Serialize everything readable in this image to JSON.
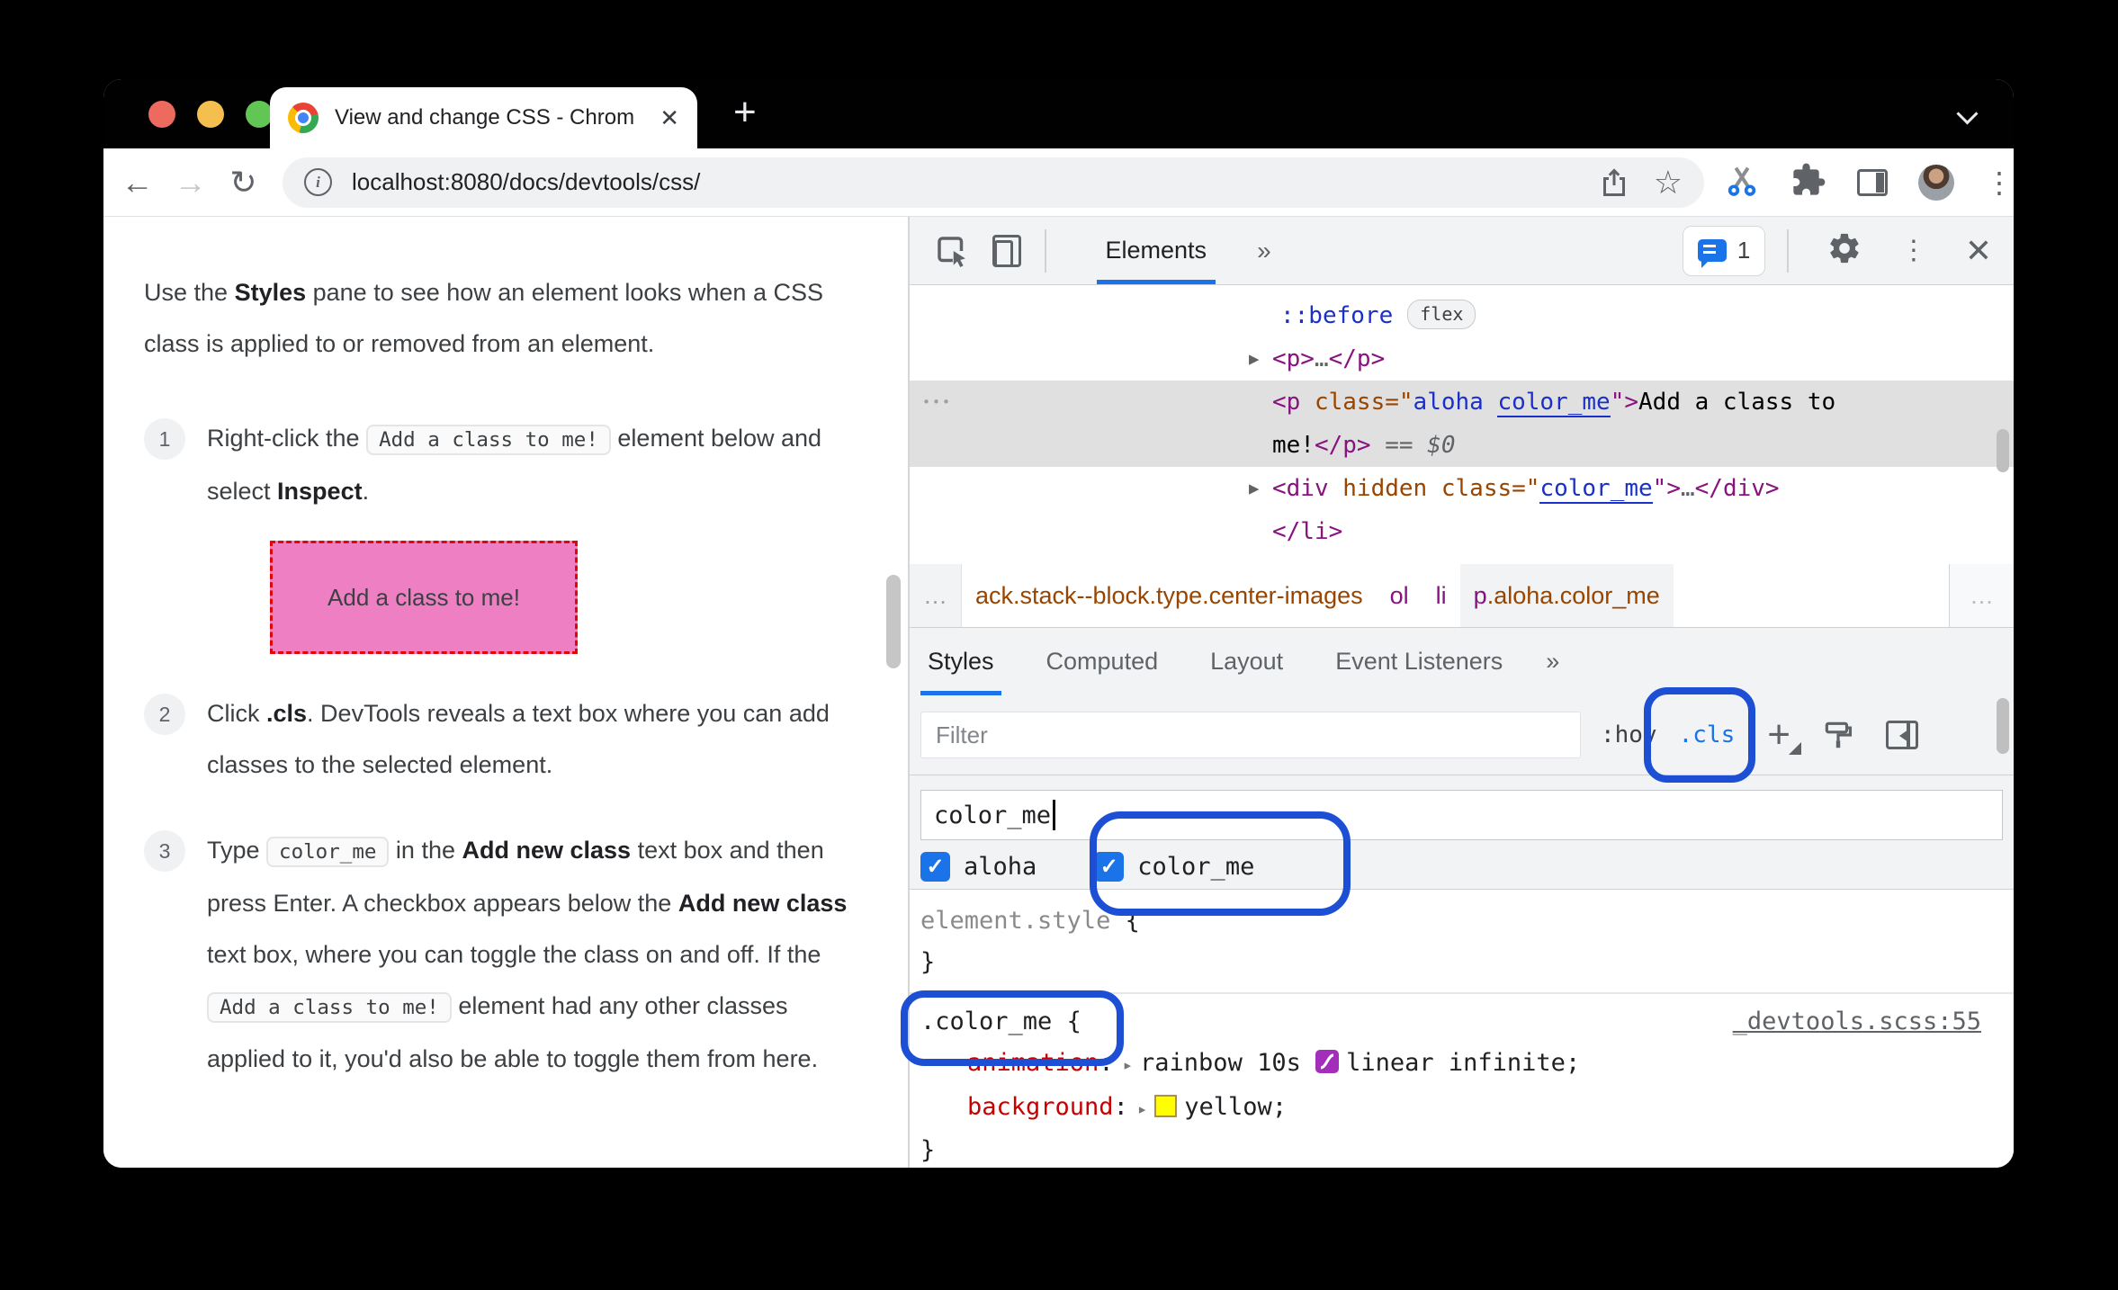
{
  "colors": {
    "accent_blue": "#1a73e8",
    "annotation_blue": "#1c4fd3",
    "tag_purple": "#881280",
    "attr_orange": "#994500",
    "value_blue": "#1a30c8",
    "property_red": "#c80000",
    "dom_selection_gray": "#e0e0e0",
    "demo_box_pink": "#ee7fc3",
    "demo_box_border_red": "#df0707",
    "swatch_yellow": "#ffff00",
    "swatch_bezier_purple": "#a32eba",
    "traffic_red": "#ed6a5e",
    "traffic_yellow": "#f4bf4f",
    "traffic_green": "#61c653"
  },
  "browser": {
    "tab_title": "View and change CSS - Chrom",
    "tab_close": "✕",
    "new_tab": "+",
    "url": "localhost:8080/docs/devtools/css/",
    "back": "←",
    "forward": "→",
    "reload": "↻",
    "star": "☆",
    "kebab": "⋮"
  },
  "doc": {
    "intro": {
      "t0": "Use the ",
      "b": "Styles",
      "t1": " pane to see how an element looks when a CSS class is applied to or removed from an element."
    },
    "step1": {
      "num": "1",
      "t0": "Right-click the ",
      "code": "Add a class to me!",
      "t1": " element below and select ",
      "b": "Inspect",
      "t2": "."
    },
    "demo_box": "Add a class to me!",
    "step2": {
      "num": "2",
      "t0": "Click ",
      "b": ".cls",
      "t1": ". DevTools reveals a text box where you can add classes to the selected element."
    },
    "step3": {
      "num": "3",
      "t0": "Type ",
      "code1": "color_me",
      "t1": " in the ",
      "b1": "Add new class",
      "t2": " text box and then press Enter. A checkbox appears below the ",
      "b2": "Add new class",
      "t3": " text box, where you can toggle the class on and off. If the ",
      "code2": "Add a class to me!",
      "t4": " element had any other classes applied to it, you'd also be able to toggle them from here."
    }
  },
  "devtools": {
    "toolbar": {
      "tab": "Elements",
      "more": "»",
      "badge_count": "1",
      "kebab": "⋮",
      "close": "✕"
    },
    "dom": {
      "pseudo": "::before",
      "pseudo_badge": "flex",
      "p_collapsed": {
        "tri": "▶",
        "open": "<p>",
        "dots": "…",
        "close": "</p>"
      },
      "selected": {
        "gutter_dots": "•••",
        "open": "<p",
        "attr": " class",
        "eq": "=\"",
        "val1": "aloha ",
        "val2": "color_me",
        "endq": "\">",
        "text1": "Add a class to",
        "text2": "me!",
        "close": "</p>",
        "eqeq": " == ",
        "dollar": "$0"
      },
      "div_row": {
        "tri": "▶",
        "open": "<div",
        "hidden": " hidden",
        "attr": " class",
        "eq": "=\"",
        "val": "color_me",
        "endq": "\">",
        "dots": "…",
        "close": "</div>"
      },
      "li_close": "</li>"
    },
    "breadcrumb": {
      "left_more": "…",
      "crumb1": "ack.stack--block.type.center-images",
      "crumb2": "ol",
      "crumb3": "li",
      "crumb4_tag": "p",
      "crumb4_classes": ".aloha.color_me",
      "right_more": "…"
    },
    "subtabs": {
      "styles": "Styles",
      "computed": "Computed",
      "layout": "Layout",
      "event_listeners": "Event Listeners",
      "more": "»"
    },
    "styles": {
      "filter_placeholder": "Filter",
      "hov": ":hov",
      "cls": ".cls",
      "plus": "+",
      "new_class_value": "color_me",
      "checkbox1": "aloha",
      "checkbox2": "color_me",
      "check_mark": "✓",
      "element_style": {
        "selector": "element.style",
        "brace_open": " {",
        "brace_close": "}"
      },
      "rule": {
        "selector": ".color_me",
        "brace_open": " {",
        "brace_close": "}",
        "source_link": "_devtools.scss:55",
        "prop1": {
          "name": "animation",
          "colon": ":",
          "tri": "▸",
          "v1": "rainbow 10s",
          "v2": "linear infinite;"
        },
        "prop2": {
          "name": "background",
          "colon": ":",
          "tri": "▸",
          "v1": "yellow;"
        }
      }
    }
  }
}
